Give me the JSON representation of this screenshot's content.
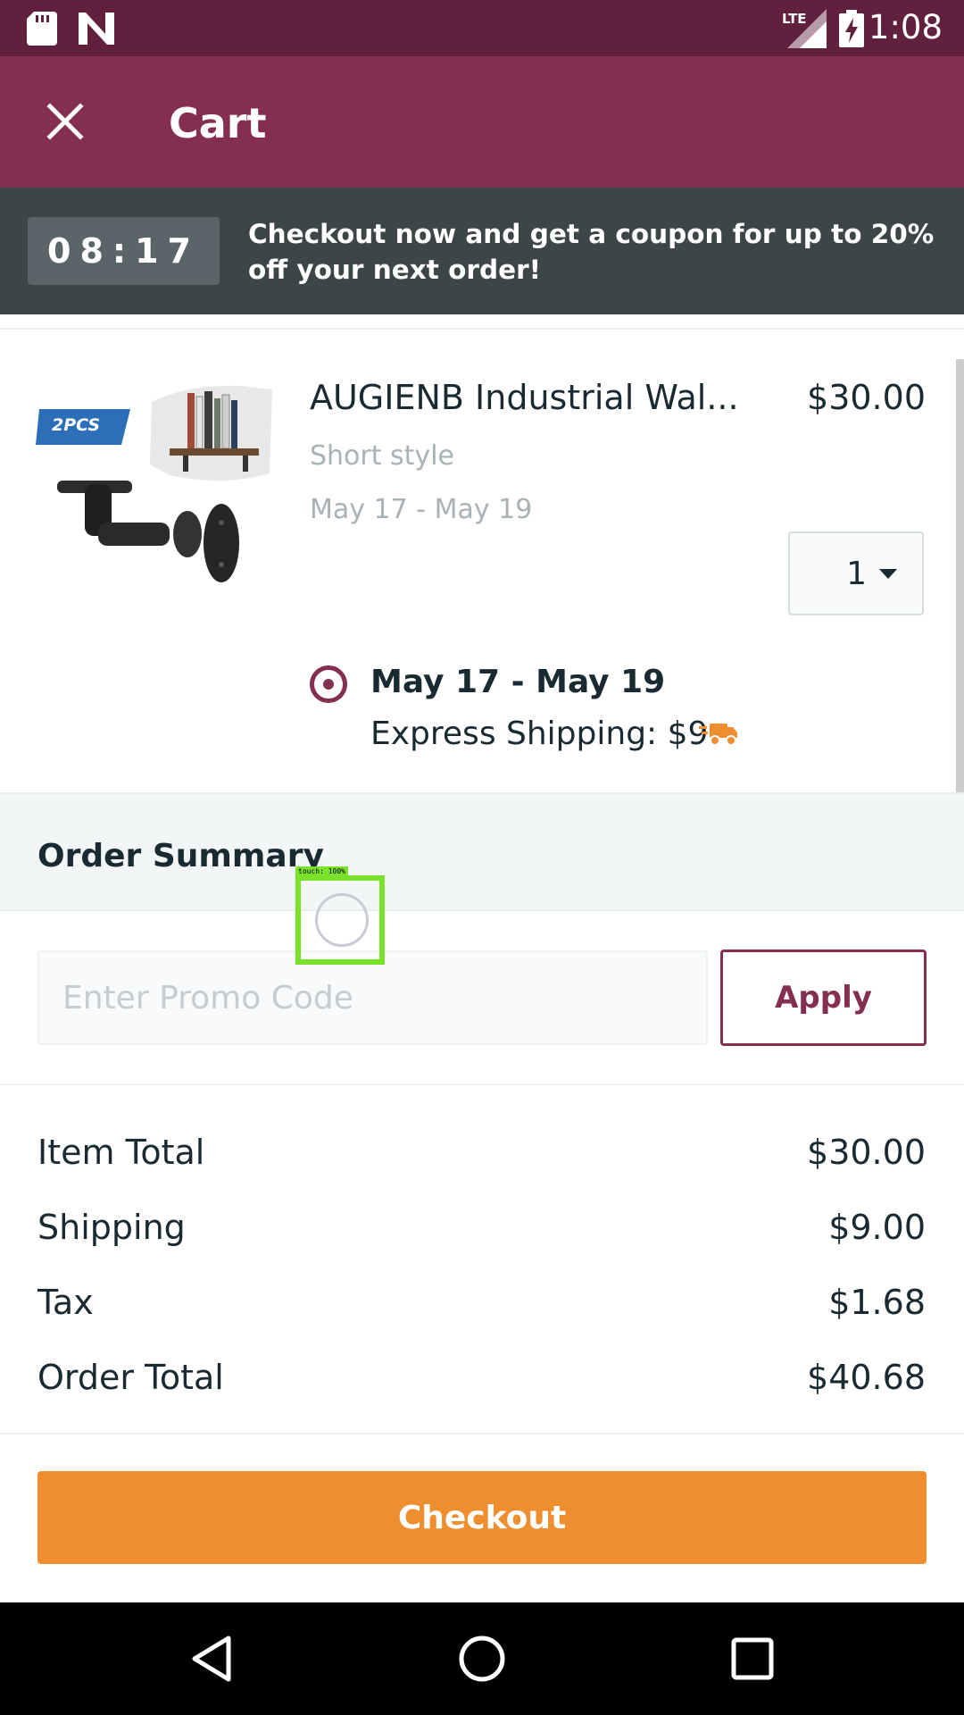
{
  "status_bar": {
    "time": "1:08",
    "network": "LTE",
    "icons": [
      "sd-card-icon",
      "n-app-icon",
      "lte-signal-icon",
      "battery-charging-icon"
    ]
  },
  "app_bar": {
    "title": "Cart",
    "close_icon": "close-icon"
  },
  "promo_banner": {
    "timer": "08:17",
    "text": "Checkout now and get a coupon for up to 20% off your next order!"
  },
  "cart_item": {
    "name": "AUGIENB Industrial Wal...",
    "price": "$30.00",
    "variant": "Short style",
    "delivery_window": "May 17 - May 19",
    "quantity": "1",
    "image_badge": "2PCS",
    "shipping_option": {
      "date": "May 17 - May 19",
      "label": "Express Shipping: $9",
      "icon": "delivery-truck-icon",
      "selected": true
    }
  },
  "order_summary": {
    "title": "Order Summary",
    "promo_placeholder": "Enter Promo Code",
    "apply_label": "Apply",
    "rows": [
      {
        "label": "Item Total",
        "value": "$30.00"
      },
      {
        "label": "Shipping",
        "value": "$9.00"
      },
      {
        "label": "Tax",
        "value": "$1.68"
      },
      {
        "label": "Order Total",
        "value": "$40.68"
      }
    ],
    "checkout_label": "Checkout"
  },
  "touch_overlay": {
    "label": "touch: 100%"
  },
  "nav_bar": {
    "icons": [
      "back-icon",
      "home-icon",
      "recents-icon"
    ]
  },
  "colors": {
    "status_bar": "#62203f",
    "app_bar": "#842e52",
    "banner": "#3c4548",
    "accent": "#842e52",
    "checkout": "#ee8e2f"
  }
}
